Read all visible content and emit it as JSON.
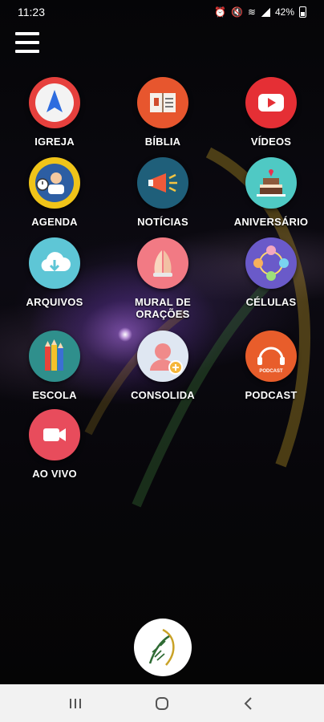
{
  "status_bar": {
    "time": "11:23",
    "battery": "42%"
  },
  "menu": {
    "icon": "hamburger-menu-icon"
  },
  "tiles": [
    {
      "label": "IGREJA",
      "icon": "navigation-arrow-icon",
      "color": "#e6403d"
    },
    {
      "label": "BÍBLIA",
      "icon": "open-bible-icon",
      "color": "#e7562e"
    },
    {
      "label": "VÍDEOS",
      "icon": "play-video-icon",
      "color": "#e52f35"
    },
    {
      "label": "AGENDA",
      "icon": "agenda-person-clock-icon",
      "color": "#f0c419"
    },
    {
      "label": "NOTÍCIAS",
      "icon": "megaphone-icon",
      "color": "#1f5f7a"
    },
    {
      "label": "ANIVERSÁRIO",
      "icon": "birthday-cake-icon",
      "color": "#4fc9c4"
    },
    {
      "label": "ARQUIVOS",
      "icon": "cloud-download-icon",
      "color": "#5ec6d6"
    },
    {
      "label": "MURAL DE\nORAÇÕES",
      "icon": "praying-hands-icon",
      "color": "#f27a84"
    },
    {
      "label": "CÉLULAS",
      "icon": "group-people-icon",
      "color": "#6a5ac9"
    },
    {
      "label": "ESCOLA",
      "icon": "pencils-icon",
      "color": "#2f8f8c"
    },
    {
      "label": "CONSOLIDA",
      "icon": "add-person-icon",
      "color": "#dfe7f2"
    },
    {
      "label": "PODCAST",
      "icon": "podcast-headphones-icon",
      "color": "#e85d2b",
      "badge": "PODCAST"
    },
    {
      "label": "AO VIVO",
      "icon": "video-camera-icon",
      "color": "#e84c5c"
    }
  ],
  "logo": {
    "icon": "leaf-logo-icon"
  },
  "nav": {
    "recents": "recents-icon",
    "home": "home-icon",
    "back": "back-icon"
  }
}
